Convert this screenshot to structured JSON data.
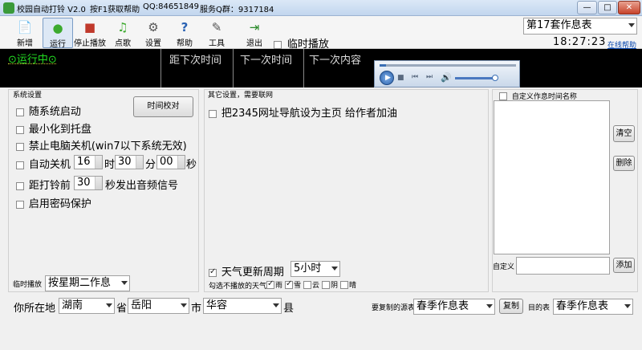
{
  "titlebar": {
    "app_title": "校园自动打铃 V2.0",
    "help_hint": "按F1获取帮助",
    "qq": "QQ:84651849",
    "service_group": "服务Q群：9317184",
    "minimize": "—",
    "maximize": "□",
    "close": "✕"
  },
  "toolbar": {
    "buttons": [
      {
        "label": "新增",
        "icon": "new-doc-icon",
        "glyph": "📄"
      },
      {
        "label": "运行",
        "icon": "run-icon",
        "glyph": "●"
      },
      {
        "label": "停止播放",
        "icon": "stop-icon",
        "glyph": "■"
      },
      {
        "label": "点歌",
        "icon": "song-request-icon",
        "glyph": "♫"
      },
      {
        "label": "设置",
        "icon": "settings-icon",
        "glyph": "⚙"
      },
      {
        "label": "帮助",
        "icon": "help-icon",
        "glyph": "?"
      },
      {
        "label": "工具",
        "icon": "tools-icon",
        "glyph": "✎"
      },
      {
        "label": "退出",
        "icon": "exit-icon",
        "glyph": "⇥"
      }
    ],
    "temp_play_label": "临时播放",
    "schedule_select": "第17套作息表",
    "clock": "18:27:23",
    "online_help": "在线帮助"
  },
  "statusbar": {
    "state": "⊙运行中⊙",
    "col_time_until": "距下次时间",
    "col_next_time": "下一次时间",
    "col_next_content": "下一次内容"
  },
  "system": {
    "title": "系统设置",
    "auto_start": "随系统启动",
    "minimize_tray": "最小化到托盘",
    "disable_shutdown": "禁止电脑关机(win7以下系统无效)",
    "auto_shutdown": "自动关机",
    "shutdown_hour": "16",
    "hour_unit": "时",
    "shutdown_minute": "30",
    "minute_unit": "分",
    "shutdown_second": "00",
    "second_unit": "秒",
    "before_bell": "距打铃前",
    "before_seconds": "30",
    "before_suffix": "秒发出音频信号",
    "password": "启用密码保护",
    "calibrate_button": "时间校对",
    "temp_play_label": "临时播放",
    "temp_play_select": "按星期二作息"
  },
  "other": {
    "title": "其它设置，需要联网",
    "homepage_opt": "把2345网址导航设为主页 给作者加油",
    "weather_update": "天气更新周期",
    "weather_period": "5小时",
    "skip_weather_label": "勾选不播放的天气",
    "weather_types": [
      "雨",
      "雪",
      "云",
      "阴",
      "晴"
    ]
  },
  "custom": {
    "title": "自定义作息时间名称",
    "clear_button": "清空",
    "delete_button": "删除",
    "custom_label": "自定义",
    "add_button": "添加"
  },
  "location": {
    "prefix": "你所在地",
    "province": "湖南",
    "province_unit": "省",
    "city": "岳阳",
    "city_unit": "市",
    "county": "华容",
    "county_unit": "县"
  },
  "copy": {
    "source_label": "要复制的源表",
    "source_select": "春季作息表",
    "copy_button": "复制",
    "target_label": "目的表",
    "target_select": "春季作息表"
  }
}
